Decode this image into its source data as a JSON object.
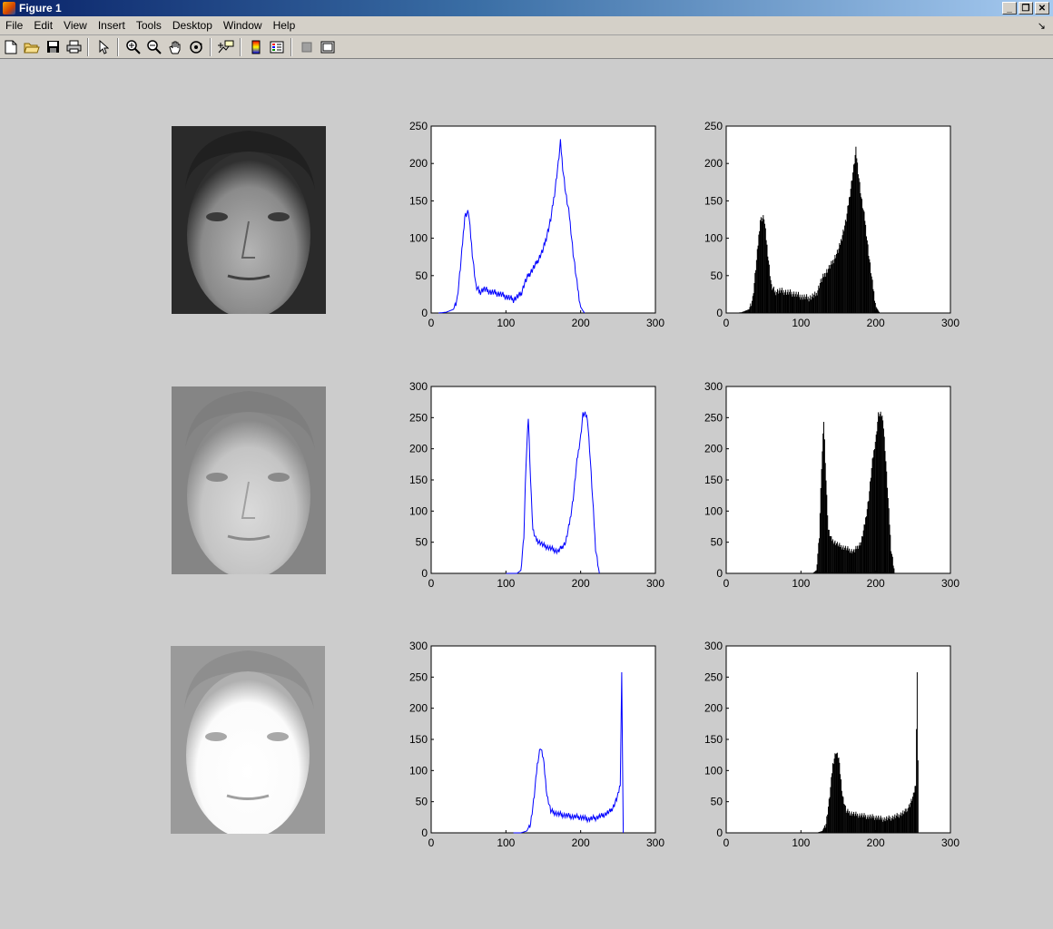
{
  "window": {
    "title": "Figure 1"
  },
  "menu": [
    "File",
    "Edit",
    "View",
    "Insert",
    "Tools",
    "Desktop",
    "Window",
    "Help"
  ],
  "toolbar": [
    "new-file-icon",
    "open-folder-icon",
    "save-icon",
    "print-icon",
    "pointer-icon",
    "zoom-in-icon",
    "zoom-out-icon",
    "pan-hand-icon",
    "rotate-3d-icon",
    "data-cursor-icon",
    "colorbar-icon",
    "legend-icon",
    "hide-tools-icon",
    "show-tools-icon"
  ],
  "colors": {
    "line_series": "#0000ff",
    "bar_series": "#000000",
    "titlebar_start": "#0a246a",
    "titlebar_end": "#a6caf0"
  },
  "chart_data": [
    {
      "row": 1,
      "type": "line",
      "xlim": [
        0,
        300
      ],
      "ylim": [
        0,
        250
      ],
      "xticks": [
        0,
        100,
        200,
        300
      ],
      "yticks": [
        0,
        50,
        100,
        150,
        200,
        250
      ],
      "x": [
        10,
        20,
        30,
        35,
        40,
        45,
        50,
        55,
        60,
        65,
        70,
        80,
        90,
        100,
        110,
        120,
        125,
        130,
        140,
        150,
        160,
        165,
        170,
        173,
        176,
        180,
        185,
        190,
        195,
        200,
        205
      ],
      "y": [
        0,
        1,
        5,
        20,
        70,
        130,
        135,
        80,
        35,
        28,
        32,
        28,
        26,
        22,
        18,
        25,
        40,
        50,
        65,
        85,
        125,
        160,
        200,
        228,
        195,
        160,
        130,
        80,
        40,
        8,
        0
      ]
    },
    {
      "row": 1,
      "type": "bar",
      "xlim": [
        0,
        300
      ],
      "ylim": [
        0,
        250
      ],
      "xticks": [
        0,
        100,
        200,
        300
      ],
      "yticks": [
        0,
        50,
        100,
        150,
        200,
        250
      ],
      "x": [
        10,
        20,
        30,
        35,
        40,
        45,
        50,
        55,
        60,
        65,
        70,
        80,
        90,
        100,
        110,
        120,
        125,
        130,
        140,
        150,
        160,
        165,
        170,
        173,
        176,
        180,
        185,
        190,
        195,
        200,
        205
      ],
      "y": [
        0,
        1,
        5,
        20,
        70,
        125,
        128,
        80,
        35,
        28,
        30,
        28,
        26,
        22,
        20,
        25,
        40,
        50,
        65,
        85,
        125,
        160,
        195,
        218,
        190,
        155,
        125,
        80,
        40,
        8,
        0
      ]
    },
    {
      "row": 2,
      "type": "line",
      "xlim": [
        0,
        300
      ],
      "ylim": [
        0,
        300
      ],
      "xticks": [
        0,
        100,
        200,
        300
      ],
      "yticks": [
        0,
        50,
        100,
        150,
        200,
        250,
        300
      ],
      "x": [
        100,
        115,
        120,
        124,
        127,
        130,
        133,
        136,
        140,
        150,
        160,
        170,
        180,
        185,
        190,
        195,
        200,
        203,
        206,
        209,
        212,
        216,
        220,
        225
      ],
      "y": [
        0,
        0,
        5,
        60,
        180,
        250,
        150,
        70,
        55,
        45,
        40,
        35,
        50,
        80,
        120,
        180,
        220,
        255,
        255,
        250,
        200,
        120,
        40,
        0
      ]
    },
    {
      "row": 2,
      "type": "bar",
      "xlim": [
        0,
        300
      ],
      "ylim": [
        0,
        300
      ],
      "xticks": [
        0,
        100,
        200,
        300
      ],
      "yticks": [
        0,
        50,
        100,
        150,
        200,
        250,
        300
      ],
      "x": [
        100,
        115,
        120,
        124,
        127,
        130,
        133,
        136,
        140,
        150,
        160,
        170,
        180,
        185,
        190,
        195,
        200,
        203,
        206,
        209,
        212,
        216,
        220,
        225
      ],
      "y": [
        0,
        0,
        5,
        60,
        170,
        245,
        150,
        70,
        55,
        45,
        40,
        35,
        50,
        80,
        120,
        180,
        220,
        255,
        255,
        250,
        200,
        120,
        40,
        0
      ]
    },
    {
      "row": 3,
      "type": "line",
      "xlim": [
        0,
        300
      ],
      "ylim": [
        0,
        300
      ],
      "xticks": [
        0,
        100,
        200,
        300
      ],
      "yticks": [
        0,
        50,
        100,
        150,
        200,
        250,
        300
      ],
      "x": [
        110,
        120,
        128,
        133,
        138,
        142,
        146,
        150,
        155,
        160,
        170,
        180,
        190,
        200,
        210,
        220,
        230,
        240,
        245,
        250,
        253,
        255,
        256,
        257
      ],
      "y": [
        0,
        0,
        3,
        15,
        60,
        110,
        138,
        120,
        60,
        35,
        30,
        28,
        26,
        25,
        22,
        24,
        28,
        35,
        45,
        60,
        80,
        255,
        120,
        0
      ]
    },
    {
      "row": 3,
      "type": "bar",
      "xlim": [
        0,
        300
      ],
      "ylim": [
        0,
        300
      ],
      "xticks": [
        0,
        100,
        200,
        300
      ],
      "yticks": [
        0,
        50,
        100,
        150,
        200,
        250,
        300
      ],
      "x": [
        110,
        120,
        128,
        133,
        138,
        142,
        146,
        150,
        155,
        160,
        170,
        180,
        190,
        200,
        210,
        220,
        230,
        240,
        245,
        250,
        253,
        255,
        256,
        257
      ],
      "y": [
        0,
        0,
        3,
        15,
        60,
        110,
        130,
        120,
        60,
        35,
        30,
        28,
        26,
        25,
        22,
        24,
        28,
        35,
        45,
        60,
        80,
        255,
        120,
        0
      ]
    }
  ]
}
